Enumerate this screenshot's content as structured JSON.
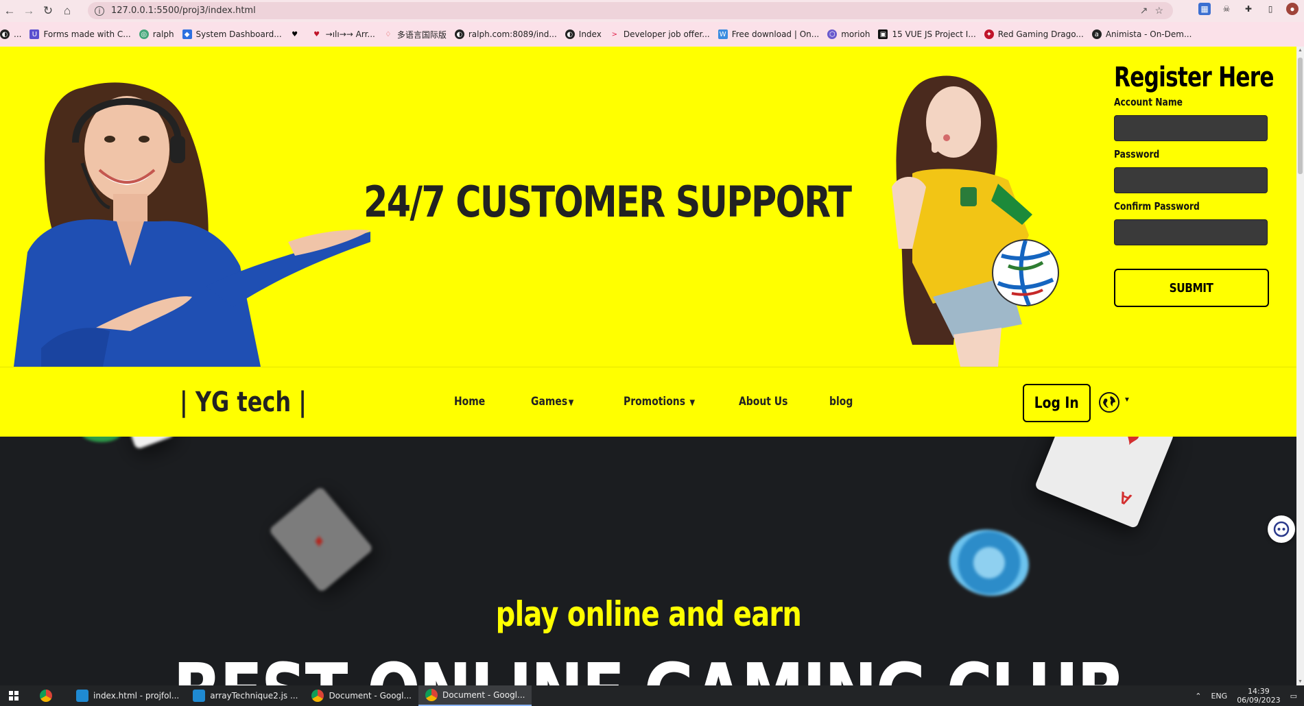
{
  "browser": {
    "url": "127.0.0.1:5500/proj3/index.html",
    "bookmarks": [
      {
        "label": "..."
      },
      {
        "label": "Forms made with C..."
      },
      {
        "label": "ralph"
      },
      {
        "label": "System Dashboard..."
      },
      {
        "label": ""
      },
      {
        "label": "→ılı→→ Arr..."
      },
      {
        "label": "多语言国际版"
      },
      {
        "label": "ralph.com:8089/ind..."
      },
      {
        "label": "Index"
      },
      {
        "label": "Developer job offer..."
      },
      {
        "label": "Free download | On..."
      },
      {
        "label": "morioh"
      },
      {
        "label": "15 VUE JS Project I..."
      },
      {
        "label": "Red Gaming Drago..."
      },
      {
        "label": "Animista - On-Dem..."
      }
    ]
  },
  "hero": {
    "headline": "24/7 CUSTOMER SUPPORT"
  },
  "register": {
    "title": "Register Here",
    "account_label": "Account Name",
    "password_label": "Password",
    "confirm_label": "Confirm Password",
    "submit_label": "SUBMIT"
  },
  "navbar": {
    "brand": "| YG tech |",
    "links": [
      {
        "label": "Home",
        "has_caret": false
      },
      {
        "label": "Games",
        "has_caret": true
      },
      {
        "label": "Promotions",
        "has_caret": true
      },
      {
        "label": "About Us",
        "has_caret": false
      },
      {
        "label": "blog",
        "has_caret": false
      }
    ],
    "login_label": "Log In"
  },
  "banner": {
    "tagline": "play online and earn",
    "title": "BEST ONLINE GAMING CLUB"
  },
  "taskbar": {
    "items": [
      {
        "label": ""
      },
      {
        "label": "index.html - projfol..."
      },
      {
        "label": "arrayTechnique2.js ..."
      },
      {
        "label": "Document - Googl..."
      },
      {
        "label": "Document - Googl..."
      }
    ],
    "lang": "ENG",
    "time": "14:39",
    "date": "06/09/2023"
  },
  "colors": {
    "accent_yellow": "#ffff00",
    "dark_bg": "#1b1d20",
    "input_bg": "#3a3a3a"
  }
}
